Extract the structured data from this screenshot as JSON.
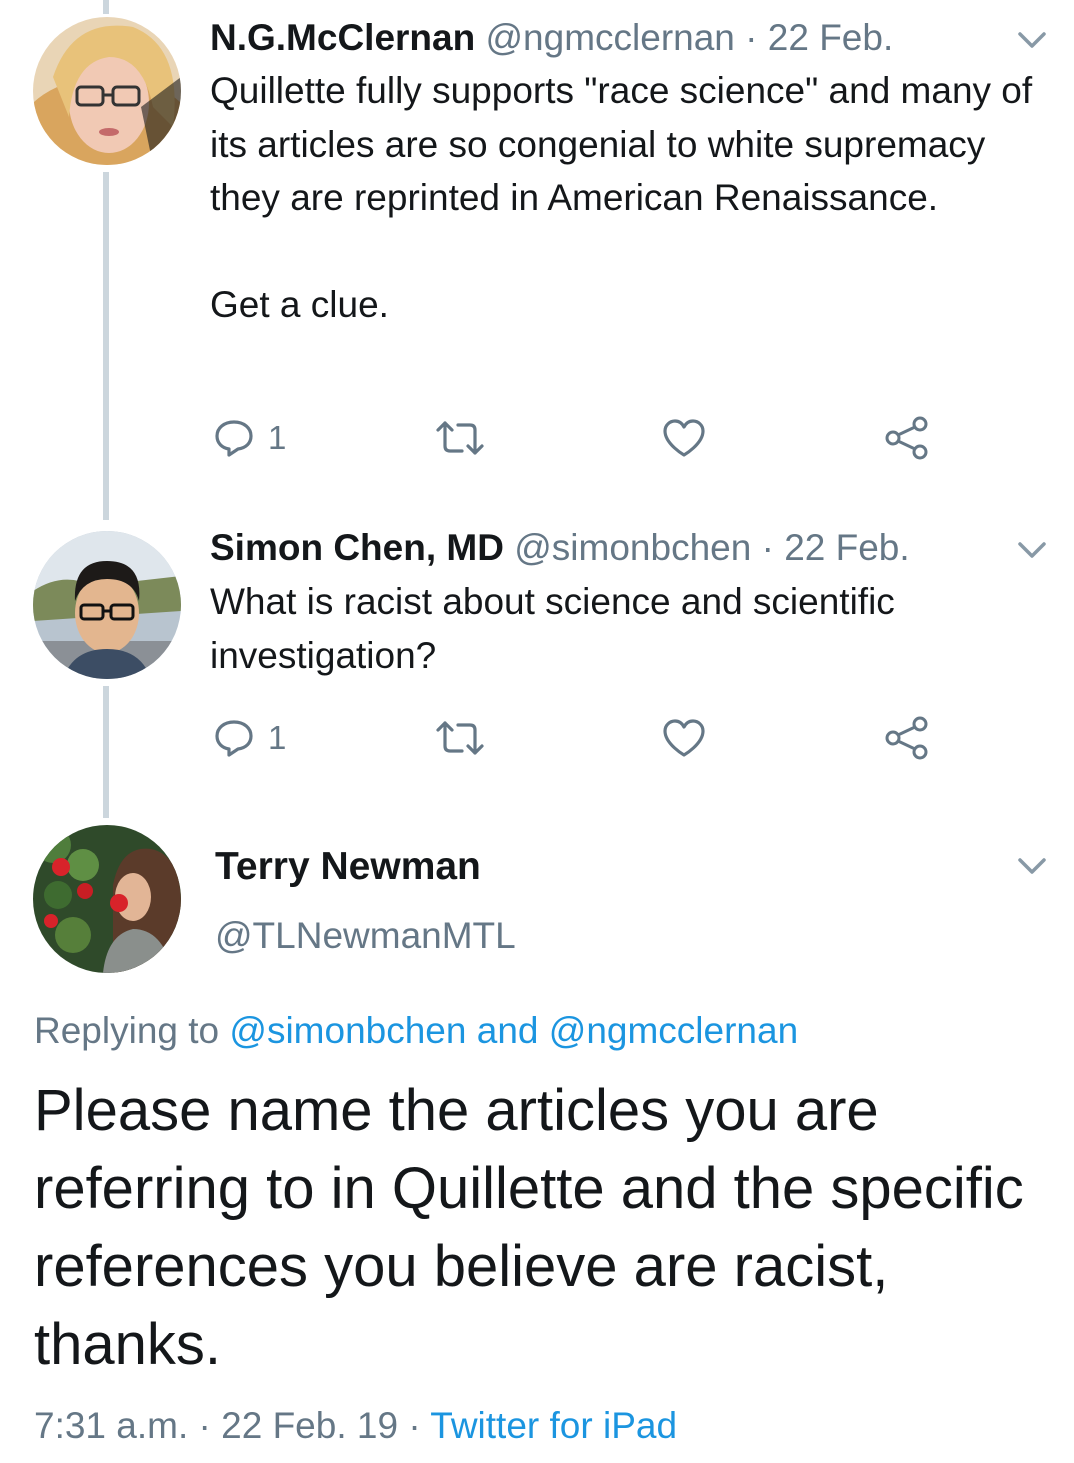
{
  "tweets": [
    {
      "name": "N.G.McClernan",
      "handle": "@ngmcclernan",
      "date": "· 22 Feb.",
      "text": "Quillette fully supports \"race science\" and many of its articles are so congenial to white supremacy they are reprinted in American Renaissance.\n\nGet a clue.",
      "reply_count": "1"
    },
    {
      "name": "Simon Chen, MD",
      "handle": "@simonbchen",
      "date": "· 22 Feb.",
      "text": "What is racist about science and scientific investigation?",
      "reply_count": "1"
    }
  ],
  "main_tweet": {
    "name": "Terry Newman",
    "handle": "@TLNewmanMTL",
    "replying_prefix": "Replying to",
    "replying_user1": "@simonbchen",
    "replying_and": "and",
    "replying_user2": "@ngmcclernan",
    "text": "Please name the articles you are referring to in Quillette and the specific references you believe are racist, thanks.",
    "time": "7:31 a.m.",
    "date": "· 22 Feb. 19 ·",
    "source": "Twitter for iPad"
  },
  "colors": {
    "text": "#14171a",
    "muted": "#657786",
    "link": "#1b95e0",
    "thread_line": "#ccd6dd"
  },
  "icons": {
    "reply": "reply-icon",
    "retweet": "retweet-icon",
    "like": "heart-icon",
    "share": "share-icon",
    "caret": "chevron-down-icon"
  }
}
